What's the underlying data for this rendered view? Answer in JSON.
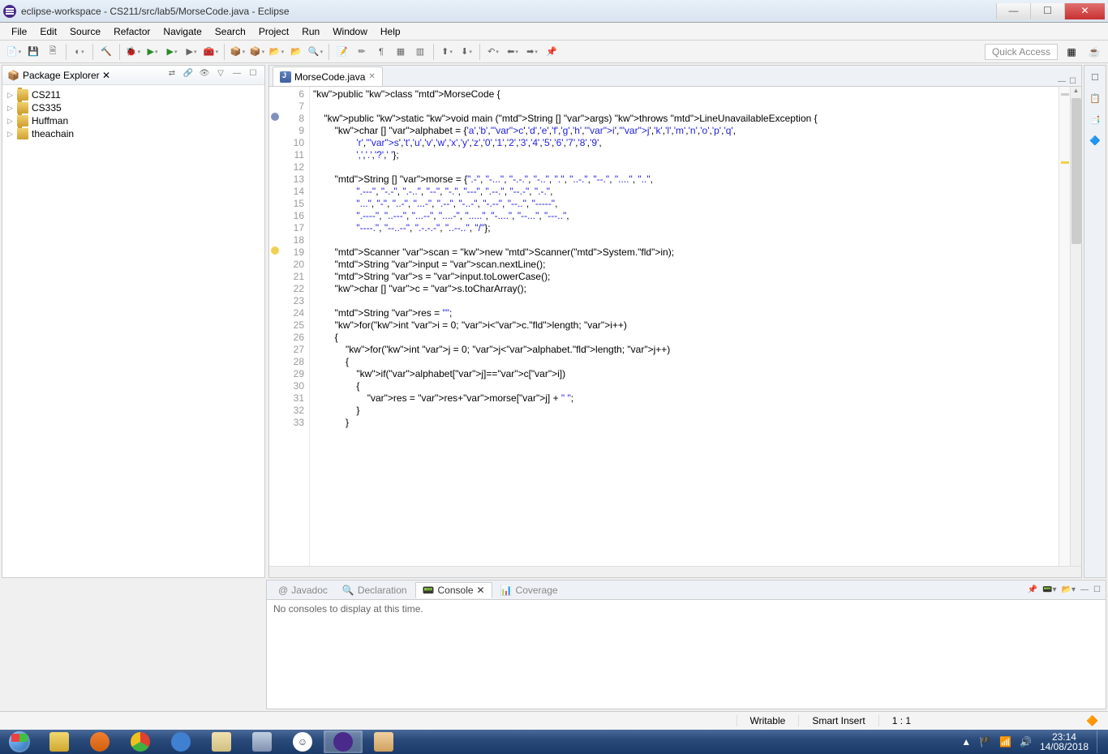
{
  "window": {
    "title": "eclipse-workspace - CS211/src/lab5/MorseCode.java - Eclipse"
  },
  "menu": [
    "File",
    "Edit",
    "Source",
    "Refactor",
    "Navigate",
    "Search",
    "Project",
    "Run",
    "Window",
    "Help"
  ],
  "quick_access": "Quick Access",
  "package_explorer": {
    "title": "Package Explorer",
    "items": [
      {
        "label": "CS211"
      },
      {
        "label": "CS335"
      },
      {
        "label": "Huffman"
      },
      {
        "label": "theachain"
      }
    ]
  },
  "editor": {
    "tab_label": "MorseCode.java",
    "first_line": 6,
    "lines": [
      "public class MorseCode {",
      "",
      "    public static void main (String [] args) throws LineUnavailableException {",
      "        char [] alphabet = {'a','b','c','d','e','f','g','h','i','j','k','l','m','n','o','p','q',",
      "                'r','s','t','u','v','w','x','y','z','0','1','2','3','4','5','6','7','8','9',",
      "                ',','.','?',' '};",
      "",
      "        String [] morse = {\".-\", \"-...\", \"-.-.\", \"-..\", \".\", \"..-.\", \"--.\", \"....\", \"..\",",
      "                \".---\", \"-.-\", \".-..\", \"--\", \"-.\", \"---\", \".--.\", \"--.-\", \".-.\",",
      "                \"...\", \"-\", \"..-\", \"...-\", \".--\", \"-..-\", \"-.--\", \"--..\", \"-----\",",
      "                \".----\", \"..---\", \"...--\", \"....-\", \".....\", \"-....\", \"--...\", \"---..\",",
      "                \"----.\", \"--..--\", \".-.-.-\", \"..--..\", \"/\"};",
      "",
      "        Scanner scan = new Scanner(System.in);",
      "        String input = scan.nextLine();",
      "        String s = input.toLowerCase();",
      "        char [] c = s.toCharArray();",
      "",
      "        String res = \"\";",
      "        for(int i = 0; i<c.length; i++)",
      "        {",
      "            for(int j = 0; j<alphabet.length; j++)",
      "            {",
      "                if(alphabet[j]==c[i])",
      "                {",
      "                    res = res+morse[j] + \" \";",
      "                }",
      "            }"
    ]
  },
  "bottom_tabs": {
    "javadoc": "Javadoc",
    "declaration": "Declaration",
    "console": "Console",
    "coverage": "Coverage"
  },
  "console": {
    "message": "No consoles to display at this time."
  },
  "status": {
    "writable": "Writable",
    "insert": "Smart Insert",
    "position": "1 : 1"
  },
  "systray": {
    "time": "23:14",
    "date": "14/08/2018"
  }
}
